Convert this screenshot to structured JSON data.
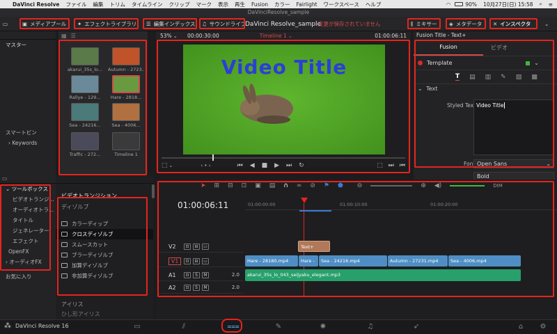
{
  "macbar": {
    "apple": "",
    "items": [
      "DaVinci Resolve",
      "ファイル",
      "編集",
      "トリム",
      "タイムライン",
      "クリップ",
      "マーク",
      "表示",
      "再生",
      "Fusion",
      "カラー",
      "Fairlight",
      "ワークスペース",
      "ヘルプ"
    ],
    "battery": "90%",
    "clock": "10月27日(日) 15:58"
  },
  "window_title": "DaVinciResolve_sample",
  "toolbar": {
    "media_pool": "メディアプール",
    "effects_library": "エフェクトライブラリ",
    "edit_index": "編集インデックス",
    "sound_library": "サウンドライブ",
    "project_name": "DaVinci Resolve_sample",
    "unsaved": "変更が保存されていません",
    "mixer": "ミキサー",
    "metadata": "メタデータ",
    "inspector": "インスペクタ"
  },
  "media": {
    "master": "マスター",
    "smart_bin": "スマートビン",
    "keywords": "Keywords",
    "clips": [
      {
        "label": "akarui_35s_lo...",
        "color": "#5a7a4a"
      },
      {
        "label": "Autumn - 2723...",
        "color": "#c0532a"
      },
      {
        "label": "Rallye - 129...",
        "color": "#6a8a9a"
      },
      {
        "label": "Hare - 2818...",
        "color": "#6a9a40"
      },
      {
        "label": "Sea - 24216...",
        "color": "#4a7a7a"
      },
      {
        "label": "Sea - 4006...",
        "color": "#b07040"
      },
      {
        "label": "Traffic - 272...",
        "color": "#4a4a5a"
      },
      {
        "label": "Timeline 1",
        "color": "#3a3a3a"
      }
    ]
  },
  "viewer": {
    "zoom": "53%",
    "source_timecode": "00:00:30:00",
    "timeline_name": "Timeline 1",
    "current_timecode": "01:00:06:11",
    "overlay_title": "Video Title"
  },
  "inspector": {
    "panel_title": "Fusion Title - Text+",
    "tab_fusion": "Fusion",
    "tab_video": "ビデオ",
    "template": "Template",
    "section_text": "Text",
    "styled_text_label": "Styled Text",
    "styled_text_value": "Video Title",
    "font_label": "Font",
    "font_value": "Open Sans",
    "style_value": "Bold"
  },
  "toolbox": {
    "title": "ツールボックス",
    "items": [
      "ビデオトランジ...",
      "オーディオトラ...",
      "タイトル",
      "ジェネレーター",
      "エフェクト"
    ],
    "openfx": "OpenFX",
    "audio_fx": "オーディオFX",
    "favorites": "お気に入り"
  },
  "transitions": {
    "title": "ビデオトランジション",
    "category": "ディゾルブ",
    "items": [
      "カラーディップ",
      "クロスディゾルブ",
      "スムースカット",
      "ブラーディゾルブ",
      "加算ディゾルブ",
      "非加算ディゾルブ"
    ],
    "footer_category": "アイリス",
    "footer_item": "ひし形アイリス"
  },
  "timeline": {
    "timecode": "01:00:06:11",
    "ruler": [
      "01:00:00:00",
      "01:00:10:00",
      "01:00:20:00"
    ],
    "tracks": [
      {
        "name": "V2"
      },
      {
        "name": "V1"
      },
      {
        "name": "A1",
        "level": "2.0"
      },
      {
        "name": "A2",
        "level": "2.0"
      }
    ],
    "title_clip": "Text+",
    "v1_clips": [
      "Hare - 28180.mp4",
      "Hare -",
      "Sea - 24216.mp4",
      "Autumn - 27231.mp4",
      "Sea - 4006.mp4"
    ],
    "a1_clip": "akarui_35s_lo_043_seijyaku_elegant.mp3"
  },
  "footer": {
    "app": "DaVinci Resolve 16"
  }
}
